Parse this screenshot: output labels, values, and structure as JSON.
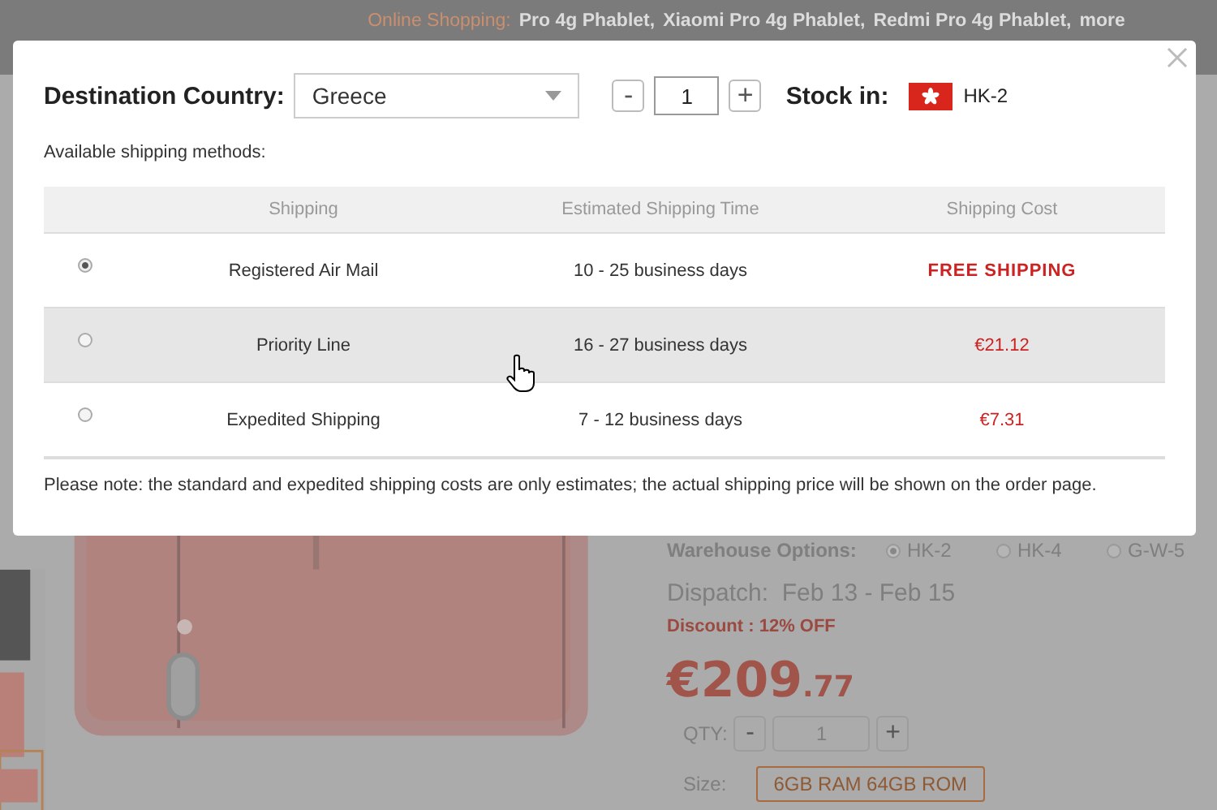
{
  "header": {
    "label": "Online Shopping:",
    "links": [
      "Pro 4g Phablet,",
      "Xiaomi Pro 4g Phablet,",
      "Redmi Pro 4g Phablet,",
      "more"
    ]
  },
  "product": {
    "warehouse_label": "Warehouse Options:",
    "warehouses": [
      {
        "label": "HK-2",
        "selected": true
      },
      {
        "label": "HK-4",
        "selected": false
      },
      {
        "label": "G-W-5",
        "selected": false
      }
    ],
    "dispatch": "Dispatch:  Feb 13 - Feb 15",
    "discount": "Discount : 12% OFF",
    "price": "€209",
    "price_cents": ".77",
    "qty_label": "QTY:",
    "qty_minus": "-",
    "qty": "1",
    "qty_plus": "+",
    "size_label": "Size:",
    "size": "6GB RAM 64GB ROM"
  },
  "dialog": {
    "destination_label": "Destination Country:",
    "country": "Greece",
    "qty_minus": "-",
    "qty": "1",
    "qty_plus": "+",
    "stock_label": "Stock in:",
    "stock": "HK-2",
    "methods_title": "Available shipping methods:",
    "columns": [
      "Shipping",
      "Estimated Shipping Time",
      "Shipping Cost"
    ],
    "rows": [
      {
        "selected": true,
        "highlighted": false,
        "method": "Registered Air Mail",
        "time": "10 - 25 business days",
        "cost": "FREE SHIPPING",
        "kind": "free"
      },
      {
        "selected": false,
        "highlighted": true,
        "method": "Priority Line",
        "time": "16 - 27 business days",
        "cost": "€21.12",
        "kind": "price"
      },
      {
        "selected": false,
        "highlighted": false,
        "method": "Expedited Shipping",
        "time": "7 - 12 business days",
        "cost": "€7.31",
        "kind": "price"
      }
    ],
    "note": "Please note: the standard and expedited shipping costs are only estimates; the actual shipping price will be shown on the order page."
  }
}
